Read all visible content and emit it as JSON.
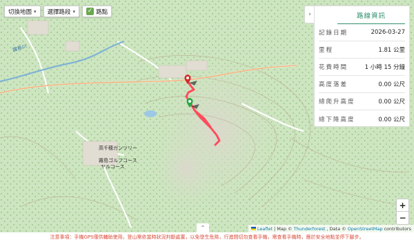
{
  "toolbar": {
    "switch_map_label": "切換地圖",
    "select_route_label": "選擇路段",
    "waypoints_label": "路點",
    "waypoints_checked": true
  },
  "stats_panel": {
    "title": "路線資訊",
    "rows": [
      {
        "label": "記錄日期",
        "value": "2026-03-27"
      },
      {
        "label": "里程",
        "value": "1.81 公里"
      },
      {
        "label": "花費時間",
        "value": "1 小時 15 分鐘"
      },
      {
        "label": "高度落差",
        "value": "0.00 公尺"
      },
      {
        "label": "總爬升高度",
        "value": "0.00 公尺"
      },
      {
        "label": "總下降高度",
        "value": "0.00 公尺"
      }
    ]
  },
  "map": {
    "labels": {
      "river_label": "霧島川",
      "course_label_1": "高千穂ガンツリー",
      "course_label_2": "霧島ゴルフコース",
      "course_label_3": "ヤルコース"
    },
    "route_color": "#ff4b5c",
    "start_marker_color": "#27a844",
    "end_marker_color": "#d42b2b"
  },
  "zoom": {
    "in_label": "+",
    "out_label": "−"
  },
  "attribution": {
    "leaflet": "Leaflet",
    "sep1": " | Map © ",
    "thunderforest": "Thunderforest",
    "sep2": ", Data © ",
    "osm": "OpenStreetMap",
    "contributors": " contributors"
  },
  "collapse_icon": "chevron-up-icon",
  "notice": "注意事項：手機GPS僅供輔助使用，登山需依當時狀況判斷處置，以免發生危險，行進間切勿查看手機，需查看手機時，應於安全地點並停下腳步。"
}
